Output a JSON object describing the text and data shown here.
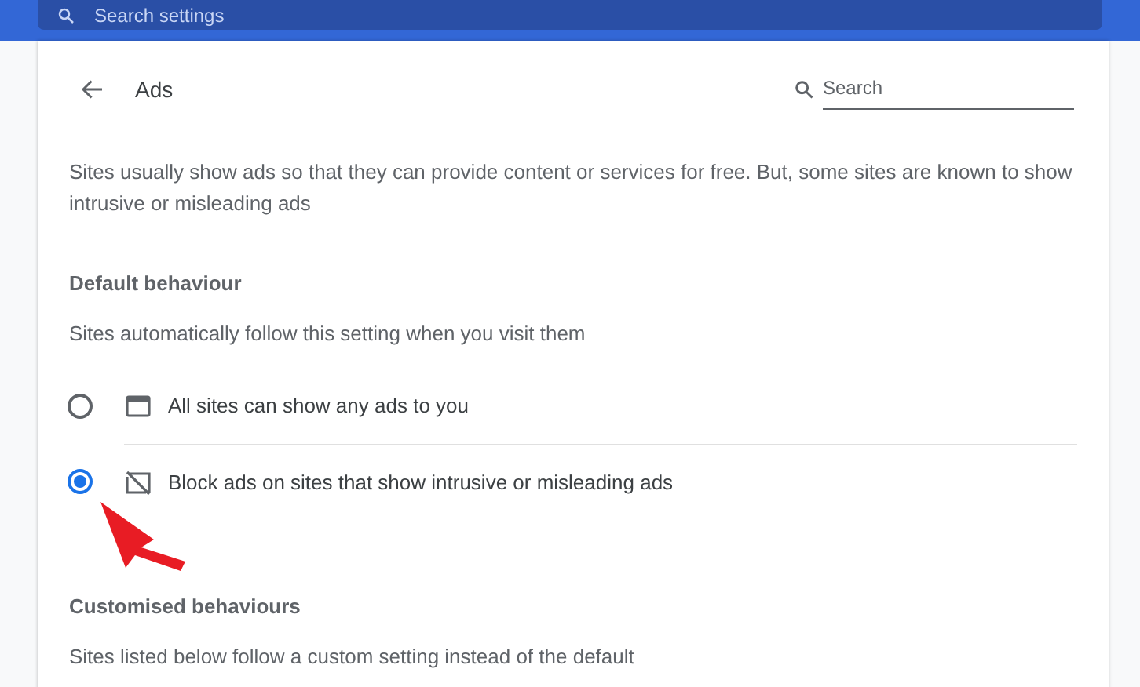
{
  "top_bar": {
    "search_placeholder": "Search settings"
  },
  "header": {
    "title": "Ads",
    "search_placeholder": "Search"
  },
  "description": "Sites usually show ads so that they can provide content or services for free. But, some sites are known to show intrusive or misleading ads",
  "default_section": {
    "heading": "Default behaviour",
    "subtitle": "Sites automatically follow this setting when you visit them",
    "options": [
      {
        "kind": "allow",
        "label": "All sites can show any ads to you",
        "selected": false
      },
      {
        "kind": "block",
        "label": "Block ads on sites that show intrusive or misleading ads",
        "selected": true
      }
    ]
  },
  "custom_section": {
    "heading": "Customised behaviours",
    "subtitle": "Sites listed below follow a custom setting instead of the default"
  }
}
